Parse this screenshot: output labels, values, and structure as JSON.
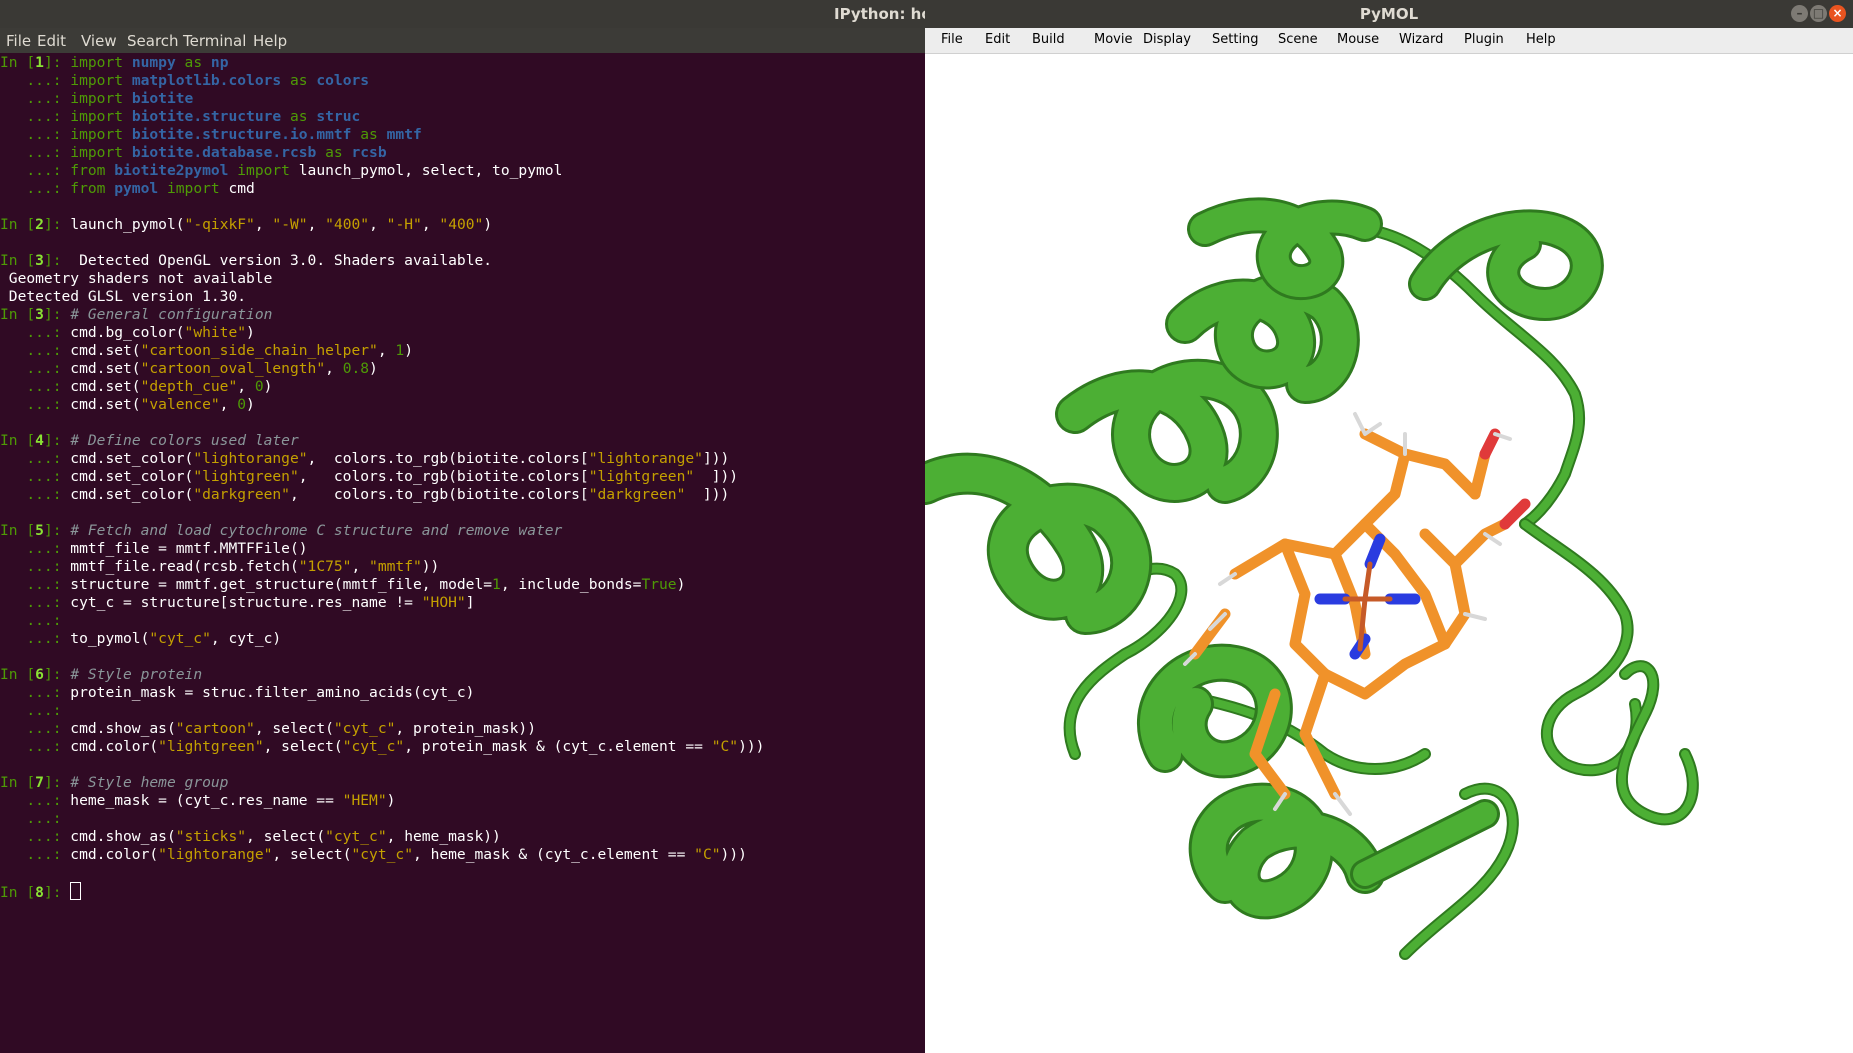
{
  "terminal": {
    "title": "IPython: hom",
    "menu": [
      "File",
      "Edit",
      "View",
      "Search",
      "Terminal",
      "Help"
    ],
    "lines": [
      {
        "prompt": "In",
        "num": "1",
        "segs": [
          [
            "kw",
            "import "
          ],
          [
            "mod",
            "numpy"
          ],
          [
            "kw",
            " as "
          ],
          [
            "mod",
            "np"
          ]
        ]
      },
      {
        "segs": [
          [
            "kw",
            "import "
          ],
          [
            "mod",
            "matplotlib.colors"
          ],
          [
            "kw",
            " as "
          ],
          [
            "mod",
            "colors"
          ]
        ]
      },
      {
        "segs": [
          [
            "kw",
            "import "
          ],
          [
            "mod",
            "biotite"
          ]
        ]
      },
      {
        "segs": [
          [
            "kw",
            "import "
          ],
          [
            "mod",
            "biotite.structure"
          ],
          [
            "kw",
            " as "
          ],
          [
            "mod",
            "struc"
          ]
        ]
      },
      {
        "segs": [
          [
            "kw",
            "import "
          ],
          [
            "mod",
            "biotite.structure.io.mmtf"
          ],
          [
            "kw",
            " as "
          ],
          [
            "mod",
            "mmtf"
          ]
        ]
      },
      {
        "segs": [
          [
            "kw",
            "import "
          ],
          [
            "mod",
            "biotite.database.rcsb"
          ],
          [
            "kw",
            " as "
          ],
          [
            "mod",
            "rcsb"
          ]
        ]
      },
      {
        "segs": [
          [
            "kw",
            "from "
          ],
          [
            "mod",
            "biotite2pymol"
          ],
          [
            "kw",
            " import "
          ],
          [
            "t",
            "launch_pymol, select, to_pymol"
          ]
        ]
      },
      {
        "segs": [
          [
            "kw",
            "from "
          ],
          [
            "mod",
            "pymol"
          ],
          [
            "kw",
            " import "
          ],
          [
            "t",
            "cmd"
          ]
        ]
      },
      {
        "blank": true
      },
      {
        "prompt": "In",
        "num": "2",
        "segs": [
          [
            "t",
            "launch_pymol("
          ],
          [
            "st",
            "\"-qixkF\""
          ],
          [
            "t",
            ", "
          ],
          [
            "st",
            "\"-W\""
          ],
          [
            "t",
            ", "
          ],
          [
            "st",
            "\"400\""
          ],
          [
            "t",
            ", "
          ],
          [
            "st",
            "\"-H\""
          ],
          [
            "t",
            ", "
          ],
          [
            "st",
            "\"400\""
          ],
          [
            "t",
            ")"
          ]
        ]
      },
      {
        "blank": true
      },
      {
        "prompt": "In",
        "num": "3",
        "segs": [
          [
            "t",
            " Detected OpenGL version 3.0. Shaders available."
          ]
        ]
      },
      {
        "raw": true,
        "segs": [
          [
            "t",
            " Geometry shaders not available"
          ]
        ]
      },
      {
        "raw": true,
        "segs": [
          [
            "t",
            " Detected GLSL version 1.30."
          ]
        ]
      },
      {
        "prompt": "In",
        "num": "3",
        "segs": [
          [
            "cm",
            "# General configuration"
          ]
        ]
      },
      {
        "segs": [
          [
            "t",
            "cmd.bg_color("
          ],
          [
            "st",
            "\"white\""
          ],
          [
            "t",
            ")"
          ]
        ]
      },
      {
        "segs": [
          [
            "t",
            "cmd.set("
          ],
          [
            "st",
            "\"cartoon_side_chain_helper\""
          ],
          [
            "t",
            ", "
          ],
          [
            "nm",
            "1"
          ],
          [
            "t",
            ")"
          ]
        ]
      },
      {
        "segs": [
          [
            "t",
            "cmd.set("
          ],
          [
            "st",
            "\"cartoon_oval_length\""
          ],
          [
            "t",
            ", "
          ],
          [
            "nm",
            "0.8"
          ],
          [
            "t",
            ")"
          ]
        ]
      },
      {
        "segs": [
          [
            "t",
            "cmd.set("
          ],
          [
            "st",
            "\"depth_cue\""
          ],
          [
            "t",
            ", "
          ],
          [
            "nm",
            "0"
          ],
          [
            "t",
            ")"
          ]
        ]
      },
      {
        "segs": [
          [
            "t",
            "cmd.set("
          ],
          [
            "st",
            "\"valence\""
          ],
          [
            "t",
            ", "
          ],
          [
            "nm",
            "0"
          ],
          [
            "t",
            ")"
          ]
        ]
      },
      {
        "blank": true
      },
      {
        "prompt": "In",
        "num": "4",
        "segs": [
          [
            "cm",
            "# Define colors used later"
          ]
        ]
      },
      {
        "segs": [
          [
            "t",
            "cmd.set_color("
          ],
          [
            "st",
            "\"lightorange\""
          ],
          [
            "t",
            ",  colors.to_rgb(biotite.colors["
          ],
          [
            "st",
            "\"lightorange\""
          ],
          [
            "t",
            "]))"
          ]
        ]
      },
      {
        "segs": [
          [
            "t",
            "cmd.set_color("
          ],
          [
            "st",
            "\"lightgreen\""
          ],
          [
            "t",
            ",   colors.to_rgb(biotite.colors["
          ],
          [
            "st",
            "\"lightgreen\""
          ],
          [
            "t",
            "  ]))"
          ]
        ]
      },
      {
        "segs": [
          [
            "t",
            "cmd.set_color("
          ],
          [
            "st",
            "\"darkgreen\""
          ],
          [
            "t",
            ",    colors.to_rgb(biotite.colors["
          ],
          [
            "st",
            "\"darkgreen\""
          ],
          [
            "t",
            "  ]))"
          ]
        ]
      },
      {
        "blank": true
      },
      {
        "prompt": "In",
        "num": "5",
        "segs": [
          [
            "cm",
            "# Fetch and load cytochrome C structure and remove water"
          ]
        ]
      },
      {
        "segs": [
          [
            "t",
            "mmtf_file = mmtf.MMTFFile()"
          ]
        ]
      },
      {
        "segs": [
          [
            "t",
            "mmtf_file.read(rcsb.fetch("
          ],
          [
            "st",
            "\"1C75\""
          ],
          [
            "t",
            ", "
          ],
          [
            "st",
            "\"mmtf\""
          ],
          [
            "t",
            "))"
          ]
        ]
      },
      {
        "segs": [
          [
            "t",
            "structure = mmtf.get_structure(mmtf_file, model="
          ],
          [
            "nm",
            "1"
          ],
          [
            "t",
            ", include_bonds="
          ],
          [
            "nm",
            "True"
          ],
          [
            "t",
            ")"
          ]
        ]
      },
      {
        "segs": [
          [
            "t",
            "cyt_c = structure[structure.res_name != "
          ],
          [
            "st",
            "\"HOH\""
          ],
          [
            "t",
            "]"
          ]
        ]
      },
      {
        "segs": []
      },
      {
        "segs": [
          [
            "t",
            "to_pymol("
          ],
          [
            "st",
            "\"cyt_c\""
          ],
          [
            "t",
            ", cyt_c)"
          ]
        ]
      },
      {
        "blank": true
      },
      {
        "prompt": "In",
        "num": "6",
        "segs": [
          [
            "cm",
            "# Style protein"
          ]
        ]
      },
      {
        "segs": [
          [
            "t",
            "protein_mask = struc.filter_amino_acids(cyt_c)"
          ]
        ]
      },
      {
        "segs": []
      },
      {
        "segs": [
          [
            "t",
            "cmd.show_as("
          ],
          [
            "st",
            "\"cartoon\""
          ],
          [
            "t",
            ", select("
          ],
          [
            "st",
            "\"cyt_c\""
          ],
          [
            "t",
            ", protein_mask))"
          ]
        ]
      },
      {
        "segs": [
          [
            "t",
            "cmd.color("
          ],
          [
            "st",
            "\"lightgreen\""
          ],
          [
            "t",
            ", select("
          ],
          [
            "st",
            "\"cyt_c\""
          ],
          [
            "t",
            ", protein_mask & (cyt_c.element == "
          ],
          [
            "st",
            "\"C\""
          ],
          [
            "t",
            ")))"
          ]
        ]
      },
      {
        "blank": true
      },
      {
        "prompt": "In",
        "num": "7",
        "segs": [
          [
            "cm",
            "# Style heme group"
          ]
        ]
      },
      {
        "segs": [
          [
            "t",
            "heme_mask = (cyt_c.res_name == "
          ],
          [
            "st",
            "\"HEM\""
          ],
          [
            "t",
            ")"
          ]
        ]
      },
      {
        "segs": []
      },
      {
        "segs": [
          [
            "t",
            "cmd.show_as("
          ],
          [
            "st",
            "\"sticks\""
          ],
          [
            "t",
            ", select("
          ],
          [
            "st",
            "\"cyt_c\""
          ],
          [
            "t",
            ", heme_mask))"
          ]
        ]
      },
      {
        "segs": [
          [
            "t",
            "cmd.color("
          ],
          [
            "st",
            "\"lightorange\""
          ],
          [
            "t",
            ", select("
          ],
          [
            "st",
            "\"cyt_c\""
          ],
          [
            "t",
            ", heme_mask & (cyt_c.element == "
          ],
          [
            "st",
            "\"C\""
          ],
          [
            "t",
            ")))"
          ]
        ]
      },
      {
        "blank": true
      },
      {
        "prompt": "In",
        "num": "8",
        "cursor": true,
        "segs": []
      }
    ]
  },
  "pymol": {
    "title": "PyMOL",
    "menu": [
      "File",
      "Edit",
      "Build",
      "Movie",
      "Display",
      "Setting",
      "Scene",
      "Mouse",
      "Wizard",
      "Plugin",
      "Help"
    ],
    "colors": {
      "protein": "#4caf34",
      "heme_carbon": "#f0922a",
      "nitrogen": "#2a3ce0",
      "oxygen": "#e03a3a",
      "iron": "#c65a28",
      "hydrogen": "#e8e8e8"
    }
  }
}
